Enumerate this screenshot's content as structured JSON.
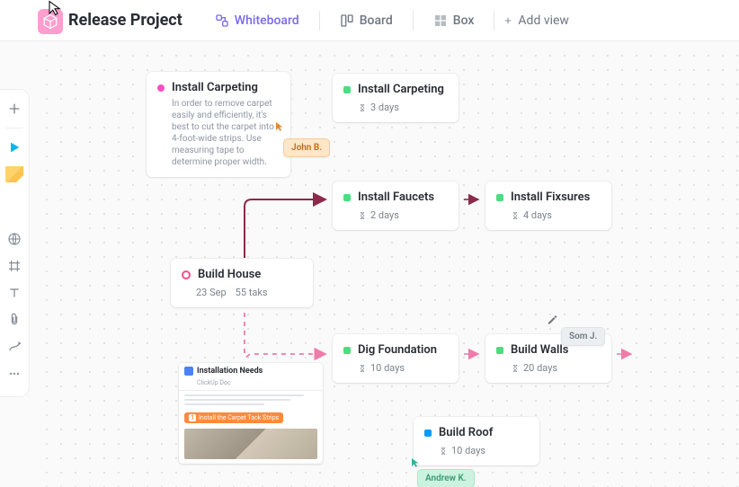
{
  "header": {
    "project_title": "Release Project",
    "views": {
      "whiteboard": "Whiteboard",
      "board": "Board",
      "box": "Box",
      "add": "Add view"
    }
  },
  "cards": {
    "carpet_a": {
      "title": "Install Carpeting",
      "desc": "In order to remove carpet easily and efficiently, it's best to cut the carpet into 4-foot-wide strips. Use measuring tape to determine proper width."
    },
    "carpet_b": {
      "title": "Install Carpeting",
      "duration": "3 days"
    },
    "faucets": {
      "title": "Install Faucets",
      "duration": "2 days"
    },
    "fixtures": {
      "title": "Install Fixsures",
      "duration": "4 days"
    },
    "house": {
      "title": "Build House",
      "date": "23 Sep",
      "tasks": "55 taks"
    },
    "dig": {
      "title": "Dig Foundation",
      "duration": "10 days"
    },
    "walls": {
      "title": "Build Walls",
      "duration": "20 days"
    },
    "roof": {
      "title": "Build Roof",
      "duration": "10 days"
    }
  },
  "people": {
    "john": "John B.",
    "som": "Som J.",
    "andrew": "Andrew K."
  },
  "doc": {
    "title": "Installation Needs",
    "subtitle": "ClickUp Doc",
    "button": "Install the Carpet Tack Strips"
  },
  "colors": {
    "accent": "#7b68ee",
    "pink": "#ff4dc4",
    "green": "#4ade80",
    "blue": "#009cff",
    "ring": "#f44f8a"
  }
}
